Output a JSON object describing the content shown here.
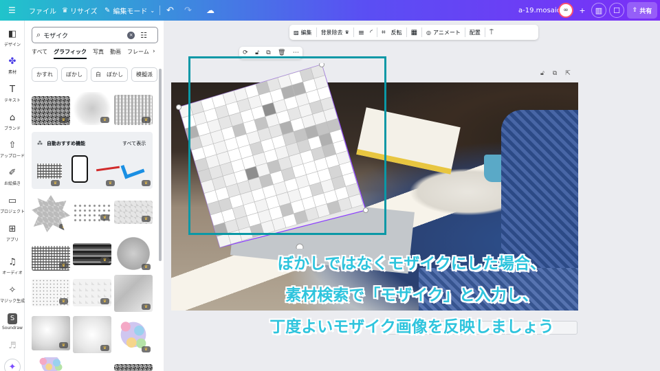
{
  "topbar": {
    "menu_icon": "menu-icon",
    "file_label": "ファイル",
    "resize_label": "リサイズ",
    "edit_mode_label": "編集モード",
    "undo_icon": "undo-icon",
    "redo_icon": "redo-icon",
    "cloud_icon": "cloud-save-icon",
    "document_name": "a-19.mosaic",
    "share_label": "共有"
  },
  "rail": {
    "items": [
      {
        "label": "デザイン",
        "icon": "layout-icon"
      },
      {
        "label": "素材",
        "icon": "elements-icon"
      },
      {
        "label": "テキスト",
        "icon": "text-icon"
      },
      {
        "label": "ブランド",
        "icon": "brand-icon"
      },
      {
        "label": "アップロード",
        "icon": "upload-icon"
      },
      {
        "label": "お絵描き",
        "icon": "draw-icon"
      },
      {
        "label": "プロジェクト",
        "icon": "folder-icon"
      },
      {
        "label": "アプリ",
        "icon": "apps-icon"
      },
      {
        "label": "オーディオ",
        "icon": "audio-icon"
      },
      {
        "label": "マジック生成",
        "icon": "magic-media-icon"
      },
      {
        "label": "Soundraw",
        "icon": "soundraw-icon"
      }
    ]
  },
  "panel": {
    "search": {
      "value": "モザイク",
      "placeholder": "モザイク"
    },
    "tabs": [
      {
        "label": "すべて",
        "active": false
      },
      {
        "label": "グラフィック",
        "active": true
      },
      {
        "label": "写真",
        "active": false
      },
      {
        "label": "動画",
        "active": false
      },
      {
        "label": "フレーム",
        "active": false
      }
    ],
    "chips": [
      "かすれ",
      "ぼかし",
      "白　ぼかし",
      "模擬派"
    ],
    "feature": {
      "title": "自動おすすめ機能",
      "link": "すべて表示"
    }
  },
  "context_toolbar": {
    "edit_label": "編集",
    "bg_remove_label": "背景除去",
    "flip_label": "反転",
    "animate_label": "アニメート",
    "arrange_label": "配置"
  },
  "caption": {
    "line1": "ぼかしではなくモザイクにした場合、",
    "line2": "素材検索で「モザイク」と入力し、",
    "line3": "丁度よいモザイク画像を反映しましょう"
  },
  "colors": {
    "accent": "#7d2ae8",
    "caption": "#2ec4dd",
    "highlight": "#0a98a6"
  }
}
